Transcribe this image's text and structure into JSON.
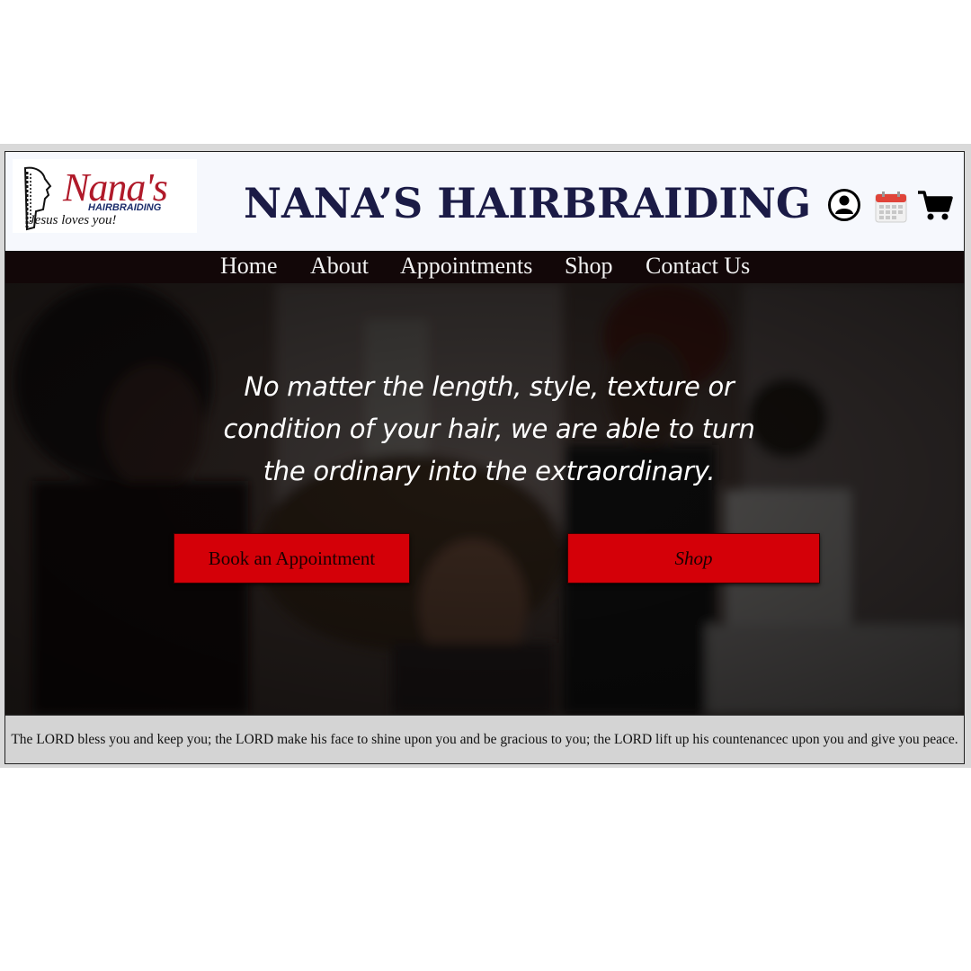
{
  "logo": {
    "script_text": "Nana's",
    "sub_text": "HAIRBRAIDING",
    "tagline": "Jesus loves you!"
  },
  "header": {
    "title": "NANA’S HAIRBRAIDING",
    "icons": [
      "user-account-icon",
      "calendar-icon",
      "shopping-cart-icon"
    ]
  },
  "nav": {
    "items": [
      {
        "label": "Home"
      },
      {
        "label": "About"
      },
      {
        "label": "Appointments"
      },
      {
        "label": "Shop"
      },
      {
        "label": "Contact Us"
      }
    ]
  },
  "hero": {
    "tagline": "No matter the length, style, texture or condition of your hair, we are able to turn the ordinary into the extraordinary.",
    "book_button_label": "Book an Appointment",
    "shop_button_label": "Shop"
  },
  "footer": {
    "blessing": "The LORD bless you and keep you; the LORD make his face to shine upon you and be gracious to you; the LORD lift up his countenancec upon you and give you peace."
  },
  "colors": {
    "nav_bg": "#120708",
    "title": "#1b1b46",
    "button_red": "#d40008",
    "footer_bg": "#d4d4d4"
  }
}
